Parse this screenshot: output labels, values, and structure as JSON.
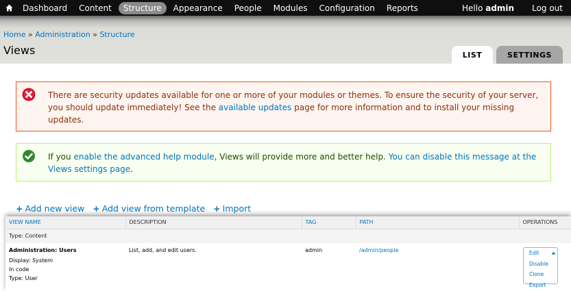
{
  "toolbar": {
    "home_icon": "home-icon",
    "items": [
      "Dashboard",
      "Content",
      "Structure",
      "Appearance",
      "People",
      "Modules",
      "Configuration",
      "Reports"
    ],
    "active": "Structure",
    "hello_prefix": "Hello ",
    "username": "admin",
    "logout": "Log out"
  },
  "breadcrumb": [
    "Home",
    "Administration",
    "Structure"
  ],
  "breadcrumb_sep": " » ",
  "page_title": "Views",
  "tabs": {
    "list": "LIST",
    "settings": "SETTINGS"
  },
  "messages": {
    "error": {
      "icon": "error-icon",
      "part1": "There are security updates available for one or more of your modules or themes. To ensure the security of your server, you should update immediately! See the ",
      "link": "available updates",
      "part2": " page for more information and to install your missing updates."
    },
    "status": {
      "icon": "check-icon",
      "part1": "If you ",
      "link1": "enable the advanced help module",
      "part2": ", Views will provide more and better help. ",
      "link2": "You can disable this message at the Views settings page",
      "part3": "."
    }
  },
  "actions": [
    "Add new view",
    "Add view from template",
    "Import"
  ],
  "table": {
    "headers": {
      "name": "VIEW NAME",
      "description": "DESCRIPTION",
      "tag": "TAG",
      "path": "PATH",
      "operations": "OPERATIONS"
    },
    "group": "Type: Content",
    "row": {
      "name": "Administration: Users",
      "display_label": "Display: ",
      "display_value": "System",
      "storage": "In code",
      "type": "Type: User",
      "description": "List, add, and edit users.",
      "tag": "admin",
      "path": "/admin/people",
      "operations": [
        "Edit",
        "Disable",
        "Clone",
        "Export"
      ]
    }
  },
  "colors": {
    "toolbar_bg": "#0f0f0f",
    "link": "#0074bd",
    "error_border": "#ed541d",
    "error_bg": "#fef5f1",
    "status_border": "#bbee77",
    "status_bg": "#f8fff0"
  }
}
